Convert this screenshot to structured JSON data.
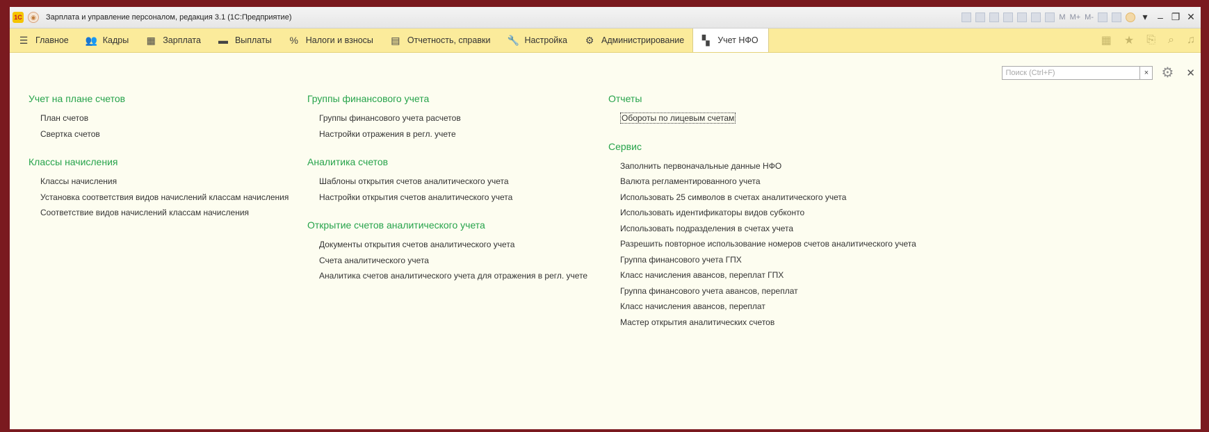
{
  "window": {
    "title": "Зарплата и управление персоналом, редакция 3.1  (1С:Предприятие)",
    "logo_text": "1С",
    "toolbar_text": [
      "M",
      "M+",
      "M-"
    ]
  },
  "menu": [
    {
      "label": "Главное",
      "icon": "☰"
    },
    {
      "label": "Кадры",
      "icon": "👥"
    },
    {
      "label": "Зарплата",
      "icon": "▦"
    },
    {
      "label": "Выплаты",
      "icon": "▬"
    },
    {
      "label": "Налоги и взносы",
      "icon": "%"
    },
    {
      "label": "Отчетность, справки",
      "icon": "▤"
    },
    {
      "label": "Настройка",
      "icon": "🔧"
    },
    {
      "label": "Администрирование",
      "icon": "⚙"
    },
    {
      "label": "Учет НФО",
      "icon": "▚"
    }
  ],
  "search": {
    "placeholder": "Поиск (Ctrl+F)",
    "value": ""
  },
  "columns": [
    {
      "groups": [
        {
          "title": "Учет на плане счетов",
          "links": [
            "План счетов",
            "Свертка счетов"
          ]
        },
        {
          "title": "Классы начисления",
          "links": [
            "Классы начисления",
            "Установка соответствия видов начислений классам начисления",
            "Соответствие видов начислений классам начисления"
          ]
        }
      ]
    },
    {
      "groups": [
        {
          "title": "Группы финансового учета",
          "links": [
            "Группы финансового учета расчетов",
            "Настройки отражения в регл. учете"
          ]
        },
        {
          "title": "Аналитика счетов",
          "links": [
            "Шаблоны открытия счетов аналитического учета",
            "Настройки открытия счетов аналитического учета"
          ]
        },
        {
          "title": "Открытие счетов аналитического учета",
          "links": [
            "Документы открытия счетов аналитического учета",
            "Счета аналитического учета",
            "Аналитика счетов аналитического учета для отражения в регл. учете"
          ]
        }
      ]
    },
    {
      "groups": [
        {
          "title": "Отчеты",
          "links": [
            "Обороты по лицевым счетам"
          ]
        },
        {
          "title": "Сервис",
          "links": [
            "Заполнить первоначальные данные НФО",
            "Валюта регламентированного учета",
            "Использовать 25 символов в счетах аналитического учета",
            "Использовать идентификаторы видов субконто",
            "Использовать подразделения в счетах учета",
            "Разрешить повторное использование номеров счетов аналитического учета",
            "Группа финансового учета ГПХ",
            "Класс начисления авансов, переплат ГПХ",
            "Группа финансового учета авансов, переплат",
            "Класс начисления авансов, переплат",
            "Мастер открытия аналитических счетов"
          ]
        }
      ]
    }
  ],
  "colors": {
    "frame": "#7a1a1f",
    "menubar": "#fbeb9b",
    "group_title": "#26a34b",
    "content_bg": "#fdfdf0"
  }
}
